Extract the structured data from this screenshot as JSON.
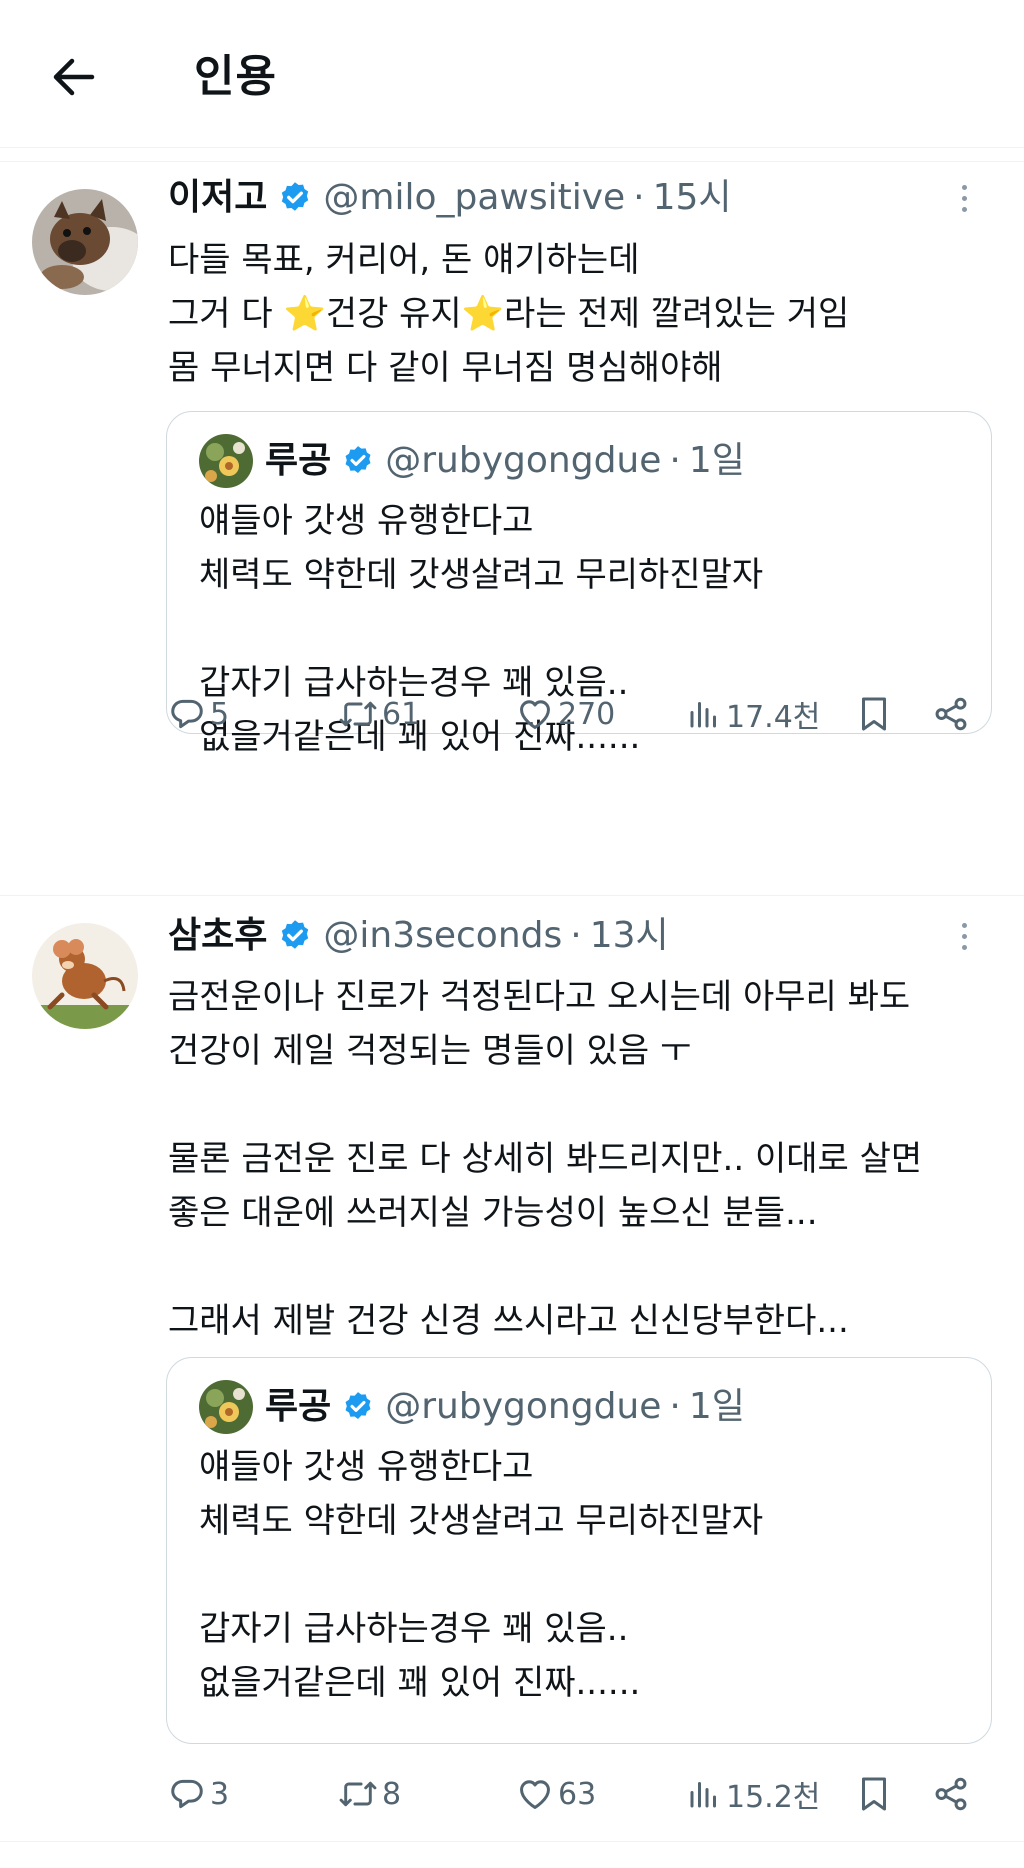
{
  "header": {
    "title": "인용",
    "back_icon": "arrow-left-icon"
  },
  "colors": {
    "verified": "#1d9bf0",
    "secondary_text": "#536471",
    "border": "#cfd9de"
  },
  "tweets": [
    {
      "name": "이저고",
      "handle": "@milo_pawsitive",
      "dot": "·",
      "time": "15시",
      "text": "다들 목표, 커리어, 돈 얘기하는데\n그거 다 ⭐건강 유지⭐라는 전제 깔려있는 거임\n몸 무너지면 다 같이 무너짐 명심해야해",
      "quote": {
        "name": "루공",
        "handle": "@rubygongdue",
        "dot": "·",
        "time": "1일",
        "text": "얘들아 갓생 유행한다고\n체력도 약한데 갓생살려고 무리하진말자\n\n갑자기 급사하는경우 꽤 있음..\n없을거같은데 꽤 있어 진짜......"
      },
      "stats": {
        "replies": "5",
        "reposts": "61",
        "likes": "270",
        "views": "17.4천"
      }
    },
    {
      "name": "삼초후",
      "handle": "@in3seconds",
      "dot": "·",
      "time": "13시",
      "text": "금전운이나 진로가 걱정된다고 오시는데 아무리 봐도\n건강이 제일 걱정되는 명들이 있음 ㅜ\n\n물론 금전운 진로 다 상세히 봐드리지만.. 이대로 살면\n좋은 대운에 쓰러지실 가능성이 높으신 분들...\n\n그래서 제발 건강 신경 쓰시라고 신신당부한다...",
      "quote": {
        "name": "루공",
        "handle": "@rubygongdue",
        "dot": "·",
        "time": "1일",
        "text": "얘들아 갓생 유행한다고\n체력도 약한데 갓생살려고 무리하진말자\n\n갑자기 급사하는경우 꽤 있음..\n없을거같은데 꽤 있어 진짜......"
      },
      "stats": {
        "replies": "3",
        "reposts": "8",
        "likes": "63",
        "views": "15.2천"
      }
    }
  ]
}
